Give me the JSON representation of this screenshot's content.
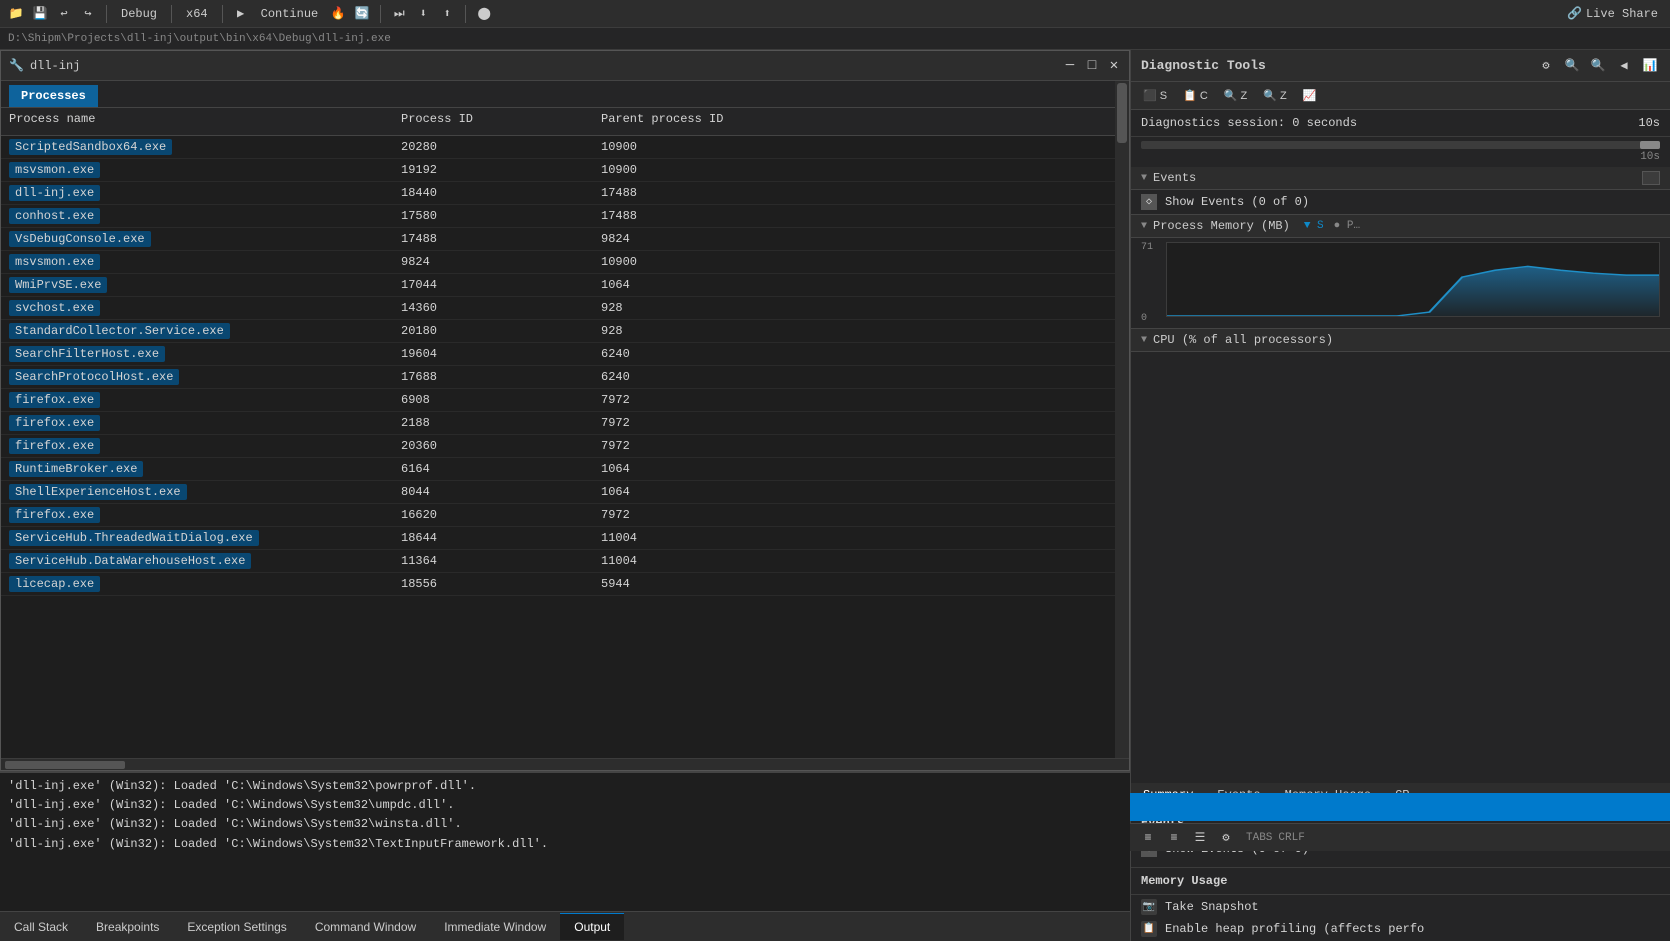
{
  "app": {
    "title": "dll-inj",
    "breadcrumb": "D:\\Shipm\\Projects\\dll-inj\\output\\bin\\x64\\Debug\\dll-inj.exe"
  },
  "toolbar": {
    "mode": "Debug",
    "arch": "x64",
    "continue_label": "Continue",
    "live_share": "Live Share"
  },
  "window": {
    "title": "dll-inj",
    "icon": "🔧"
  },
  "processes": {
    "tab_label": "Processes",
    "columns": [
      "Process name",
      "Process ID",
      "Parent process ID"
    ],
    "rows": [
      {
        "name": "ScriptedSandbox64.exe",
        "pid": "20280",
        "ppid": "10900"
      },
      {
        "name": "msvsmon.exe",
        "pid": "19192",
        "ppid": "10900"
      },
      {
        "name": "dll-inj.exe",
        "pid": "18440",
        "ppid": "17488"
      },
      {
        "name": "conhost.exe",
        "pid": "17580",
        "ppid": "17488"
      },
      {
        "name": "VsDebugConsole.exe",
        "pid": "17488",
        "ppid": "9824"
      },
      {
        "name": "msvsmon.exe",
        "pid": "9824",
        "ppid": "10900"
      },
      {
        "name": "WmiPrvSE.exe",
        "pid": "17044",
        "ppid": "1064"
      },
      {
        "name": "svchost.exe",
        "pid": "14360",
        "ppid": "928"
      },
      {
        "name": "StandardCollector.Service.exe",
        "pid": "20180",
        "ppid": "928"
      },
      {
        "name": "SearchFilterHost.exe",
        "pid": "19604",
        "ppid": "6240"
      },
      {
        "name": "SearchProtocolHost.exe",
        "pid": "17688",
        "ppid": "6240"
      },
      {
        "name": "firefox.exe",
        "pid": "6908",
        "ppid": "7972"
      },
      {
        "name": "firefox.exe",
        "pid": "2188",
        "ppid": "7972"
      },
      {
        "name": "firefox.exe",
        "pid": "20360",
        "ppid": "7972"
      },
      {
        "name": "RuntimeBroker.exe",
        "pid": "6164",
        "ppid": "1064"
      },
      {
        "name": "ShellExperienceHost.exe",
        "pid": "8044",
        "ppid": "1064"
      },
      {
        "name": "firefox.exe",
        "pid": "16620",
        "ppid": "7972"
      },
      {
        "name": "ServiceHub.ThreadedWaitDialog.exe",
        "pid": "18644",
        "ppid": "11004"
      },
      {
        "name": "ServiceHub.DataWarehouseHost.exe",
        "pid": "11364",
        "ppid": "11004"
      },
      {
        "name": "licecap.exe",
        "pid": "18556",
        "ppid": "5944"
      }
    ]
  },
  "output": {
    "tab_label": "Output",
    "lines": [
      "'dll-inj.exe' (Win32): Loaded 'C:\\Windows\\System32\\powrprof.dll'.",
      "'dll-inj.exe' (Win32): Loaded 'C:\\Windows\\System32\\umpdc.dll'.",
      "'dll-inj.exe' (Win32): Loaded 'C:\\Windows\\System32\\winsta.dll'.",
      "'dll-inj.exe' (Win32): Loaded 'C:\\Windows\\System32\\TextInputFramework.dll'."
    ]
  },
  "bottom_tabs": [
    {
      "label": "Call Stack",
      "active": false
    },
    {
      "label": "Breakpoints",
      "active": false
    },
    {
      "label": "Exception Settings",
      "active": false
    },
    {
      "label": "Command Window",
      "active": false
    },
    {
      "label": "Immediate Window",
      "active": false
    },
    {
      "label": "Output",
      "active": true
    }
  ],
  "diagnostic_tools": {
    "title": "Diagnostic Tools",
    "session_label": "Diagnostics session: 0 seconds",
    "session_time": "10s",
    "tabs": [
      "Summary",
      "Events",
      "Memory Usage",
      "CP"
    ],
    "active_tab": "Summary",
    "events_section": {
      "label": "Events",
      "show_events_label": "Show Events (0 of 0)"
    },
    "memory_section": {
      "label": "Process Memory (MB)",
      "max_value": "71",
      "min_value": "0",
      "chart_data": [
        0,
        0,
        0,
        0,
        0,
        0,
        0,
        0,
        5,
        60,
        68,
        71,
        68,
        65,
        62
      ]
    },
    "cpu_section": {
      "label": "CPU (% of all processors)",
      "max_value": "100"
    },
    "memory_usage_section": {
      "label": "Memory Usage",
      "take_snapshot_label": "Take Snapshot",
      "enable_heap_label": "Enable heap profiling (affects perfo"
    }
  },
  "right_toolbar": {
    "tabs_label": "TABS",
    "crlf_label": "CRLF"
  }
}
